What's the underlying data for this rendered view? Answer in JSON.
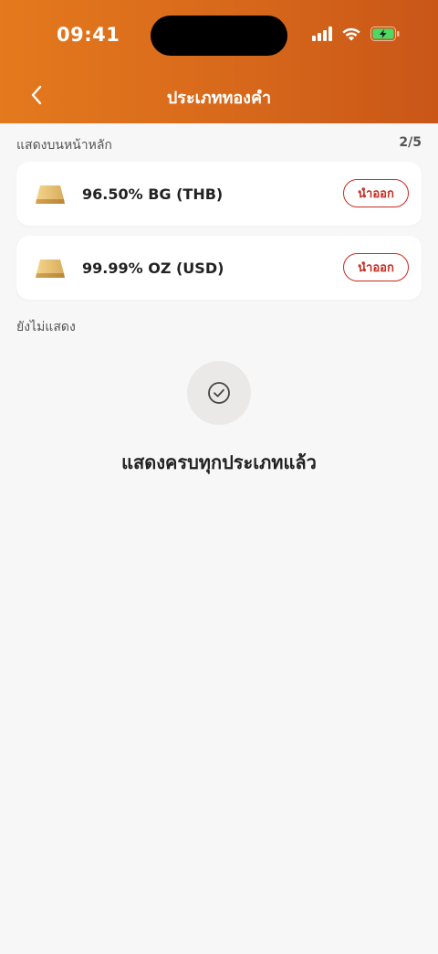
{
  "status_bar": {
    "time": "09:41"
  },
  "nav": {
    "title": "ประเภททองคำ"
  },
  "shown_section": {
    "label": "แสดงบนหน้าหลัก",
    "count": "2/5",
    "items": [
      {
        "label": "96.50% BG (THB)",
        "action_label": "นำออก"
      },
      {
        "label": "99.99% OZ (USD)",
        "action_label": "นำออก"
      }
    ]
  },
  "hidden_section": {
    "label": "ยังไม่แสดง",
    "empty_message": "แสดงครบทุกประเภทแล้ว"
  },
  "colors": {
    "header_start": "#e4791d",
    "header_end": "#c95617",
    "remove_accent": "#c62a1f",
    "battery": "#4cd964"
  },
  "icons": {
    "back": "chevron-left-icon",
    "signal": "cellular-signal-icon",
    "wifi": "wifi-icon",
    "battery": "battery-charging-icon",
    "gold": "gold-bar-icon",
    "empty_state": "check-circle-icon"
  }
}
